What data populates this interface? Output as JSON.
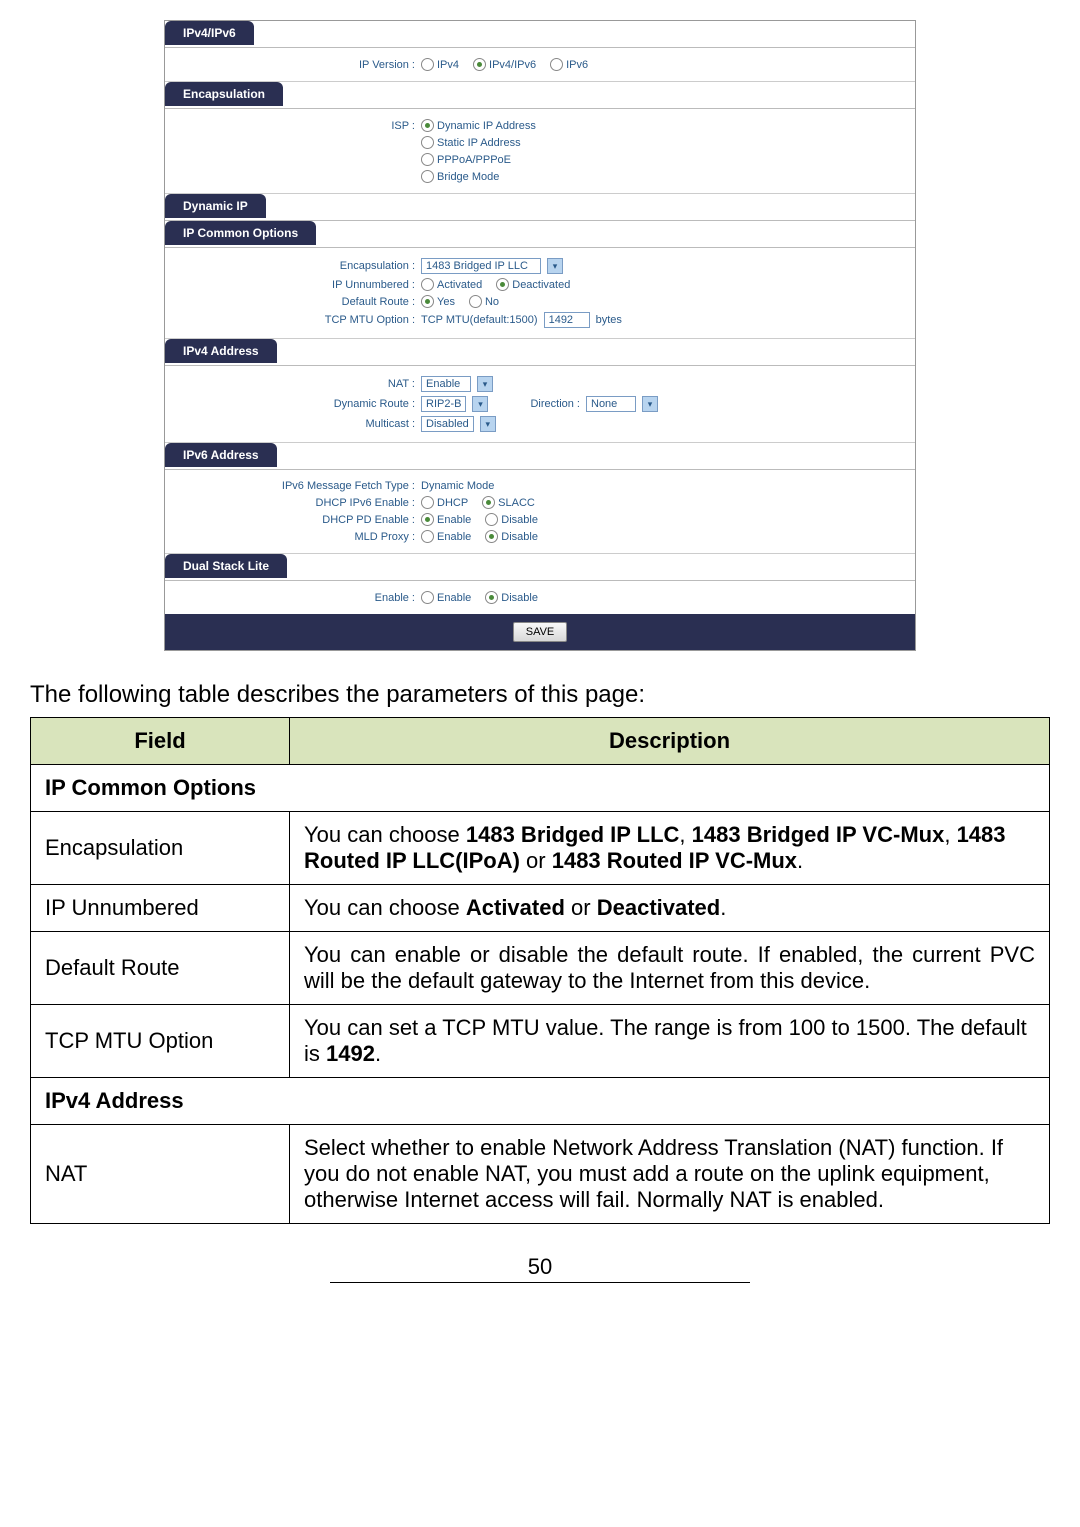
{
  "tabs": {
    "ipv4ipv6": "IPv4/IPv6",
    "encapsulation": "Encapsulation",
    "dynamic_ip": "Dynamic IP",
    "ip_common": "IP Common Options",
    "ipv4_addr": "IPv4 Address",
    "ipv6_addr": "IPv6 Address",
    "dual_stack": "Dual Stack Lite"
  },
  "ip_version": {
    "label": "IP Version :",
    "opts": {
      "ipv4": "IPv4",
      "ipv4ipv6": "IPv4/IPv6",
      "ipv6": "IPv6"
    }
  },
  "isp": {
    "label": "ISP :",
    "opts": {
      "dynamic": "Dynamic IP Address",
      "static": "Static IP Address",
      "pppoa": "PPPoA/PPPoE",
      "bridge": "Bridge Mode"
    }
  },
  "common": {
    "encap": {
      "label": "Encapsulation :",
      "value": "1483 Bridged IP LLC"
    },
    "ipun": {
      "label": "IP Unnumbered :",
      "activated": "Activated",
      "deactivated": "Deactivated"
    },
    "defroute": {
      "label": "Default Route :",
      "yes": "Yes",
      "no": "No"
    },
    "tcpmtu": {
      "label": "TCP MTU Option :",
      "text": "TCP MTU(default:1500)",
      "value": "1492",
      "unit": "bytes"
    }
  },
  "ipv4": {
    "nat": {
      "label": "NAT :",
      "value": "Enable"
    },
    "dynroute": {
      "label": "Dynamic Route :",
      "value": "RIP2-B",
      "dir_label": "Direction :",
      "dir_value": "None"
    },
    "multicast": {
      "label": "Multicast :",
      "value": "Disabled"
    }
  },
  "ipv6": {
    "fetch": {
      "label": "IPv6 Message Fetch Type :",
      "value": "Dynamic Mode"
    },
    "dhcp": {
      "label": "DHCP IPv6 Enable :",
      "dhcp": "DHCP",
      "slacc": "SLACC"
    },
    "pd": {
      "label": "DHCP PD Enable :",
      "enable": "Enable",
      "disable": "Disable"
    },
    "mld": {
      "label": "MLD Proxy :",
      "enable": "Enable",
      "disable": "Disable"
    }
  },
  "dual": {
    "label": "Enable :",
    "enable": "Enable",
    "disable": "Disable"
  },
  "save_btn": "SAVE",
  "intro": "The following table describes the parameters of this page:",
  "table": {
    "h_field": "Field",
    "h_desc": "Description",
    "ip_common_hdr": "IP Common Options",
    "encap": {
      "label": "Encapsulation",
      "t1": "You can choose ",
      "b1": "1483 Bridged IP LLC",
      "t2": ", ",
      "b2": "1483 Bridged IP VC-Mux",
      "t3": ", ",
      "b3": "1483 Routed IP LLC(IPoA)",
      "t4": " or ",
      "b4": "1483 Routed IP VC-Mux",
      "t5": "."
    },
    "ipun": {
      "label": "IP Unnumbered",
      "t1": "You can choose ",
      "b1": "Activated",
      "t2": " or ",
      "b2": "Deactivated",
      "t3": "."
    },
    "defroute": {
      "label": "Default Route",
      "text": "You can enable or disable the default route. If enabled, the current PVC will be the default gateway to the Internet from this device."
    },
    "tcpmtu": {
      "label": "TCP MTU Option",
      "t1": "You can set a TCP MTU value. The range is from 100 to 1500. The default is ",
      "b1": "1492",
      "t2": "."
    },
    "ipv4_hdr": "IPv4 Address",
    "nat": {
      "label": "NAT",
      "text": "Select whether to enable Network Address Translation (NAT) function. If you do not enable NAT, you must add a route on the uplink equipment, otherwise Internet access will fail. Normally NAT is enabled."
    }
  },
  "page_number": "50"
}
